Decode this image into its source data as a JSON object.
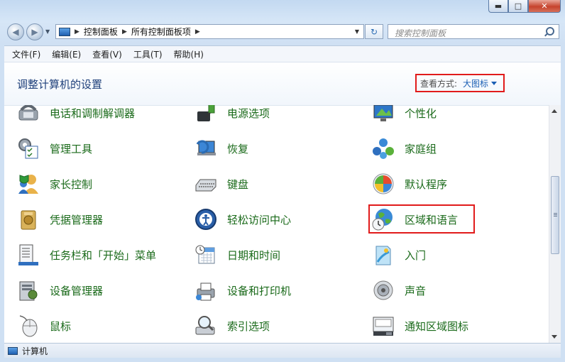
{
  "window": {
    "caption_buttons": {
      "minimize": "▬",
      "maximize": "□",
      "close": "✕"
    }
  },
  "address": {
    "back_glyph": "◀",
    "forward_glyph": "▶",
    "breadcrumbs": [
      "控制面板",
      "所有控制面板项"
    ],
    "separator": "▶",
    "refresh_glyph": "↻",
    "search_placeholder": "搜索控制面板"
  },
  "menubar": {
    "items": [
      "文件(F)",
      "编辑(E)",
      "查看(V)",
      "工具(T)",
      "帮助(H)"
    ]
  },
  "header": {
    "title": "调整计算机的设置",
    "view_label": "查看方式:",
    "view_value": "大图标"
  },
  "items": [
    {
      "label": "电话和调制解调器",
      "icon": "phone-modem-icon"
    },
    {
      "label": "电源选项",
      "icon": "power-options-icon"
    },
    {
      "label": "个性化",
      "icon": "personalization-icon"
    },
    {
      "label": "管理工具",
      "icon": "admin-tools-icon"
    },
    {
      "label": "恢复",
      "icon": "recovery-icon"
    },
    {
      "label": "家庭组",
      "icon": "homegroup-icon"
    },
    {
      "label": "家长控制",
      "icon": "parental-controls-icon"
    },
    {
      "label": "键盘",
      "icon": "keyboard-icon"
    },
    {
      "label": "默认程序",
      "icon": "default-programs-icon"
    },
    {
      "label": "凭据管理器",
      "icon": "credential-manager-icon"
    },
    {
      "label": "轻松访问中心",
      "icon": "ease-of-access-icon"
    },
    {
      "label": "区域和语言",
      "icon": "region-language-icon"
    },
    {
      "label": "任务栏和「开始」菜单",
      "icon": "taskbar-start-menu-icon"
    },
    {
      "label": "日期和时间",
      "icon": "date-time-icon"
    },
    {
      "label": "入门",
      "icon": "getting-started-icon"
    },
    {
      "label": "设备管理器",
      "icon": "device-manager-icon"
    },
    {
      "label": "设备和打印机",
      "icon": "devices-printers-icon"
    },
    {
      "label": "声音",
      "icon": "sound-icon"
    },
    {
      "label": "鼠标",
      "icon": "mouse-icon"
    },
    {
      "label": "索引选项",
      "icon": "indexing-options-icon"
    },
    {
      "label": "通知区域图标",
      "icon": "notification-area-icons-icon"
    }
  ],
  "highlighted_item": "区域和语言",
  "status": {
    "text": "计算机"
  },
  "colors": {
    "link_green": "#1a6a1a",
    "title_blue": "#1e3f7a",
    "highlight_red": "#e11b1b"
  }
}
